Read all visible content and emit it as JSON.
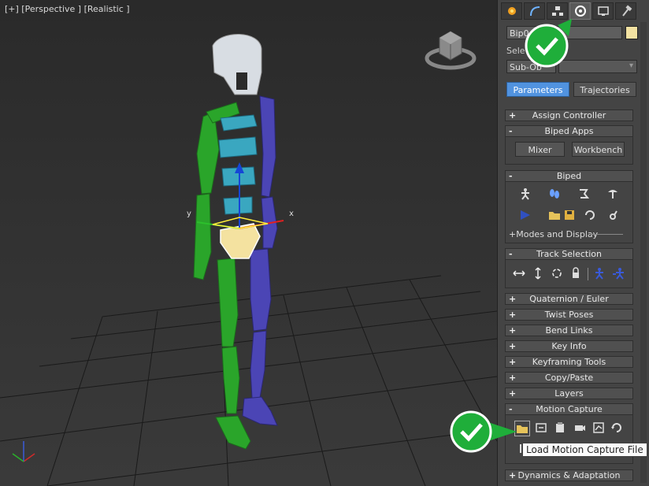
{
  "viewport": {
    "label": "[+] [Perspective ] [Realistic ]",
    "axis_x": "x",
    "axis_y": "y"
  },
  "panel": {
    "tabs": [
      {
        "icon": "create-icon",
        "active": false
      },
      {
        "icon": "modify-icon",
        "active": false
      },
      {
        "icon": "hierarchy-icon",
        "active": false
      },
      {
        "icon": "motion-icon",
        "active": true
      },
      {
        "icon": "display-icon",
        "active": false
      },
      {
        "icon": "utilities-icon",
        "active": false
      }
    ],
    "name_value": "Bip0",
    "name_color": "#f3e2a2",
    "selection_label": "Sele",
    "subobject_value": "Sub-Ob",
    "buttons": {
      "parameters": "Parameters",
      "trajectories": "Trajectories"
    },
    "rollouts": {
      "assign_controller": "Assign Controller",
      "biped_apps": "Biped Apps",
      "mixer": "Mixer",
      "workbench": "Workbench",
      "biped": "Biped",
      "modes_display": "+Modes and Display",
      "track_selection": "Track Selection",
      "quaternion": "Quaternion / Euler",
      "twist": "Twist Poses",
      "bend": "Bend Links",
      "keyinfo": "Key Info",
      "keyframing": "Keyframing Tools",
      "copypaste": "Copy/Paste",
      "layers": "Layers",
      "motion_capture": "Motion Capture",
      "dynamics": "Dynamics & Adaptation"
    },
    "signs": {
      "plus": "+",
      "minus": "-"
    },
    "tooltip": "Load Motion Capture File"
  },
  "colors": {
    "accent_blue": "#5193e0",
    "badge_green": "#1fae3a"
  }
}
